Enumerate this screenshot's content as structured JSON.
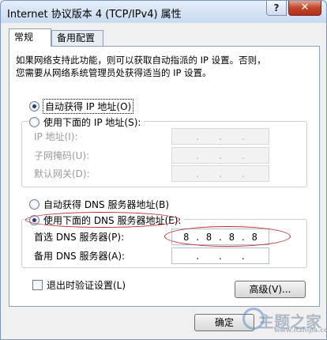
{
  "window": {
    "title": "Internet 协议版本 4 (TCP/IPv4) 属性",
    "help_label": "?",
    "close_label": "✕"
  },
  "tabs": [
    {
      "label": "常规",
      "active": true
    },
    {
      "label": "备用配置",
      "active": false
    }
  ],
  "description": {
    "line1": "如果网络支持此功能，则可以获取自动指派的 IP 设置。否则，",
    "line2": "您需要从网络系统管理员处获得适当的 IP 设置。"
  },
  "ip_section": {
    "auto_label": "自动获得 IP 地址(O)",
    "auto_selected": true,
    "manual_label": "使用下面的 IP 地址(S):",
    "manual_selected": false,
    "fields": [
      {
        "label": "IP 地址(I):",
        "value": ". . ."
      },
      {
        "label": "子网掩码(U):",
        "value": ". . ."
      },
      {
        "label": "默认网关(D):",
        "value": ". . ."
      }
    ]
  },
  "dns_section": {
    "auto_label": "自动获得 DNS 服务器地址(B)",
    "auto_selected": false,
    "manual_label": "使用下面的 DNS 服务器地址(E):",
    "manual_selected": true,
    "preferred": {
      "label": "首选 DNS 服务器(P):",
      "octets": [
        "8",
        "8",
        "8",
        "8"
      ]
    },
    "alternate": {
      "label": "备用 DNS 服务器(A):",
      "octets": [
        "",
        "",
        "",
        ""
      ]
    }
  },
  "validate_on_exit_label": "退出时验证设置(L)",
  "validate_on_exit_checked": false,
  "advanced_button_label": "高级(V)...",
  "ok_button_label": "确定",
  "watermark": {
    "text": "主题之家",
    "url": "www.itzhijia.com"
  },
  "colors": {
    "annotation_red": "#c1272d",
    "accent_blue": "#1e3f7a"
  }
}
